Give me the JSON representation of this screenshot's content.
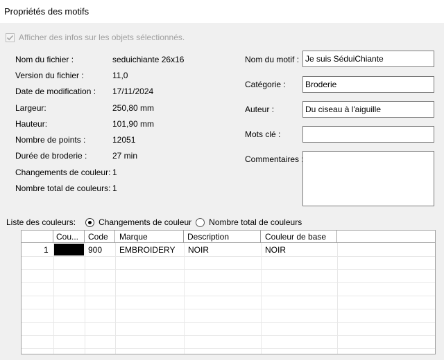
{
  "window": {
    "title": "Propriétés des motifs"
  },
  "show_info_checkbox": {
    "label": "Afficher des infos sur les objets sélectionnés.",
    "checked": true,
    "disabled": true
  },
  "info": [
    {
      "label": "Nom du fichier :",
      "value": "seduichiante 26x16"
    },
    {
      "label": "Version du fichier :",
      "value": "11,0"
    },
    {
      "label": "Date de modification :",
      "value": "17/11/2024"
    },
    {
      "label": "Largeur:",
      "value": "250,80 mm"
    },
    {
      "label": "Hauteur:",
      "value": "101,90 mm"
    },
    {
      "label": "Nombre de points :",
      "value": "12051"
    },
    {
      "label": "Durée de broderie :",
      "value": "27 min"
    },
    {
      "label": "Changements de couleur:",
      "value": "1"
    },
    {
      "label": "Nombre total de couleurs:",
      "value": "1"
    }
  ],
  "fields": {
    "motif_name": {
      "label": "Nom du motif :",
      "value": "Je suis SéduiChiante"
    },
    "category": {
      "label": "Catégorie :",
      "value": "Broderie"
    },
    "author": {
      "label": "Auteur :",
      "value": "Du ciseau à l'aiguille"
    },
    "keywords": {
      "label": "Mots clé :",
      "value": ""
    },
    "comments": {
      "label": "Commentaires :",
      "value": ""
    }
  },
  "colors_list": {
    "label": "Liste des couleurs:",
    "options": [
      "Changements de couleur",
      "Nombre total de couleurs"
    ],
    "selected": "Changements de couleur"
  },
  "table": {
    "columns": [
      "",
      "Cou...",
      "Code",
      "Marque",
      "Description",
      "Couleur de base"
    ],
    "rows": [
      {
        "index": "1",
        "color": "#000000",
        "code": "900",
        "brand": "EMBROIDERY",
        "description": "NOIR",
        "base_color": "NOIR"
      }
    ]
  }
}
